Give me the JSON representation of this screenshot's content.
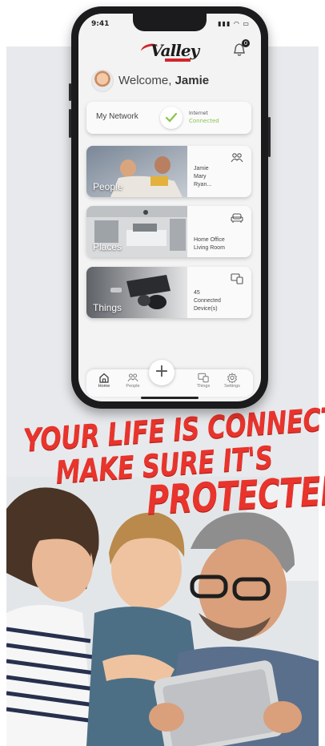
{
  "app": {
    "status_time": "9:41",
    "logo_text": "Valley",
    "notification_count": "0",
    "welcome_prefix": "Welcome,",
    "user_name": "Jamie"
  },
  "network": {
    "label": "My Network",
    "status_title": "Internet",
    "status_value": "Connected"
  },
  "tiles": [
    {
      "name": "People",
      "icon": "people-icon",
      "info": [
        "Jamie",
        "Mary",
        "Ryan..."
      ]
    },
    {
      "name": "Places",
      "icon": "couch-icon",
      "info": [
        "Home Office",
        "Living Room"
      ]
    },
    {
      "name": "Things",
      "icon": "devices-icon",
      "info": [
        "45",
        "Connected",
        "Device(s)"
      ]
    }
  ],
  "tabbar": {
    "items": [
      {
        "label": "Home",
        "icon": "home-icon"
      },
      {
        "label": "People",
        "icon": "people-icon"
      },
      {
        "label": "Things",
        "icon": "devices-icon"
      },
      {
        "label": "Settings",
        "icon": "gear-icon"
      }
    ],
    "plus_label": "+"
  },
  "slogan": {
    "line1": "YOUR LIFE IS CONNECTED,",
    "line2": "MAKE SURE IT'S",
    "line3": "PROTECTED"
  },
  "colors": {
    "accent_red": "#e8342c",
    "status_green": "#8bc34a",
    "panel_gray": "#e7e9ec"
  }
}
